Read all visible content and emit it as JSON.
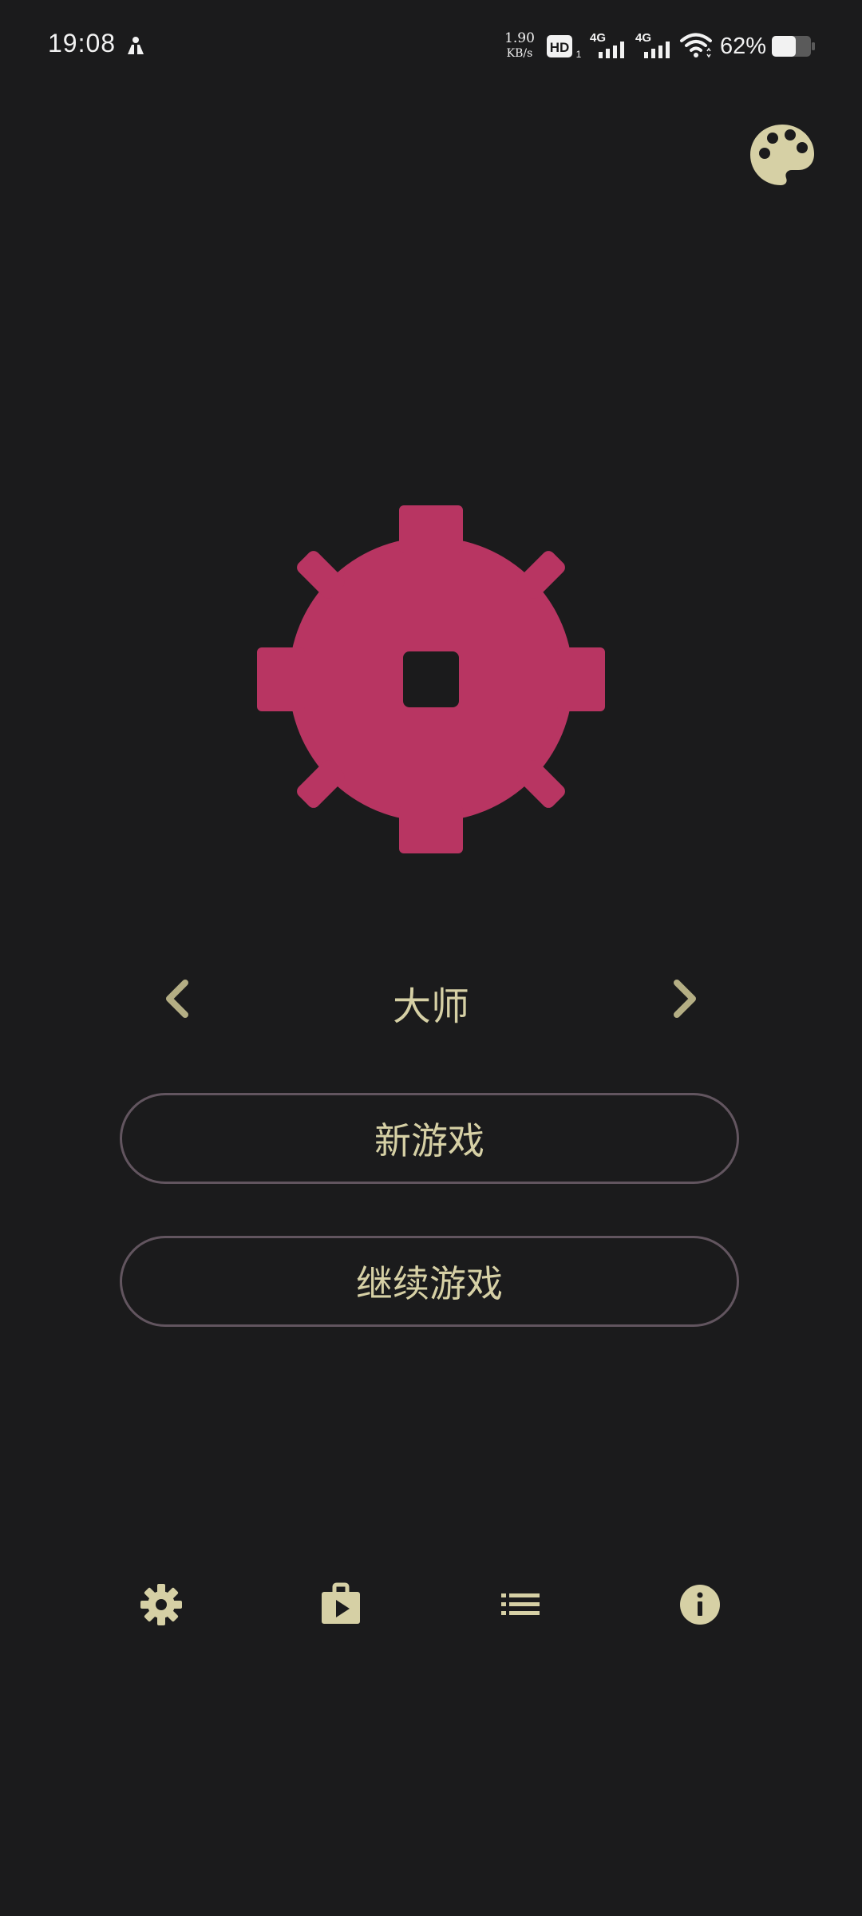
{
  "status_bar": {
    "time": "19:08",
    "net_speed_value": "1.90",
    "net_speed_unit": "KB/s",
    "hd_label": "HD",
    "hd_sub": "1",
    "signal_1_label": "4G",
    "signal_2_label": "4G",
    "battery_percent": "62%",
    "battery_level": 0.62
  },
  "difficulty": {
    "current": "大师"
  },
  "menu": {
    "new_game_label": "新游戏",
    "continue_label": "继续游戏"
  },
  "icons": {
    "palette": "palette-icon",
    "logo": "mine-gear-icon",
    "prev": "chevron-left-icon",
    "next": "chevron-right-icon",
    "settings": "gear-icon",
    "store": "play-store-bag-icon",
    "list": "list-icon",
    "info": "info-icon"
  },
  "colors": {
    "background": "#1b1b1c",
    "accent": "#b83562",
    "text": "#d6d0a5",
    "icon": "#d6d0a5",
    "button_border": "#62555f"
  }
}
